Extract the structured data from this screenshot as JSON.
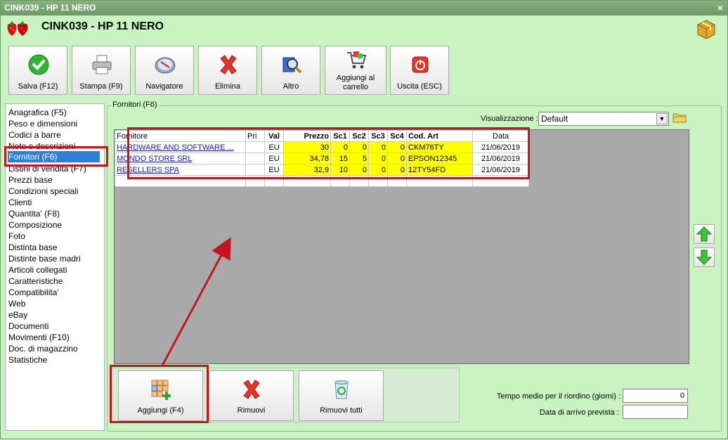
{
  "window": {
    "title": "CINK039 - HP 11 NERO",
    "close": "×"
  },
  "header": {
    "title": "CINK039 - HP 11 NERO"
  },
  "toolbar": {
    "save": "Salva (F12)",
    "print": "Stampa (F9)",
    "navigator": "Navigatore",
    "delete": "Elimina",
    "other": "Altro",
    "cart_line1": "Aggiungi al",
    "cart_line2": "carrello",
    "exit": "Uscita (ESC)"
  },
  "sidebar": {
    "items": [
      "Anagrafica (F5)",
      "Peso e dimensioni",
      "Codici a barre",
      "Note e descrizioni",
      "Fornitori (F6)",
      "Listini di vendita (F7)",
      "Prezzi base",
      "Condizioni speciali",
      "Clienti",
      "Quantita' (F8)",
      "Composizione",
      "Foto",
      "Distinta base",
      "Distinte base madri",
      "Articoli collegati",
      "Caratteristiche",
      "Compatibilita'",
      "Web",
      "eBay",
      "Documenti",
      "Movimenti (F10)",
      "Doc. di magazzino",
      "Statistiche"
    ],
    "selected_index": 4
  },
  "panel": {
    "title": "Fornitori (F6)",
    "view_label": "Visualizzazione :",
    "view_value": "Default"
  },
  "table": {
    "headers": [
      "Fornitore",
      "Pri",
      "Val",
      "Prezzo",
      "Sc1",
      "Sc2",
      "Sc3",
      "Sc4",
      "Cod. Art",
      "Data"
    ],
    "rows": [
      [
        "HARDWARE AND SOFTWARE ...",
        "",
        "EU",
        "30",
        "0",
        "0",
        "0",
        "0",
        "CKM76TY",
        "21/06/2019"
      ],
      [
        "MONDO STORE SRL",
        "",
        "EU",
        "34,78",
        "15",
        "5",
        "0",
        "0",
        "EPSON12345",
        "21/06/2019"
      ],
      [
        "RESELLERS SPA",
        "",
        "EU",
        "32,9",
        "10",
        "0",
        "0",
        "0",
        "12TY54FD",
        "21/06/2019"
      ]
    ]
  },
  "bottom": {
    "add": "Aggiungi (F4)",
    "remove": "Rimuovi",
    "remove_all": "Rimuovi tutti",
    "reorder_label": "Tempo medio per il riordino (giorni) :",
    "reorder_value": "0",
    "arrival_label": "Data di arrivo prevista :",
    "arrival_value": ""
  },
  "colors": {
    "highlight": "#c8141e",
    "selection": "#2f7fd8",
    "price_cells": "#ffff00",
    "background": "#c9f3c1"
  }
}
